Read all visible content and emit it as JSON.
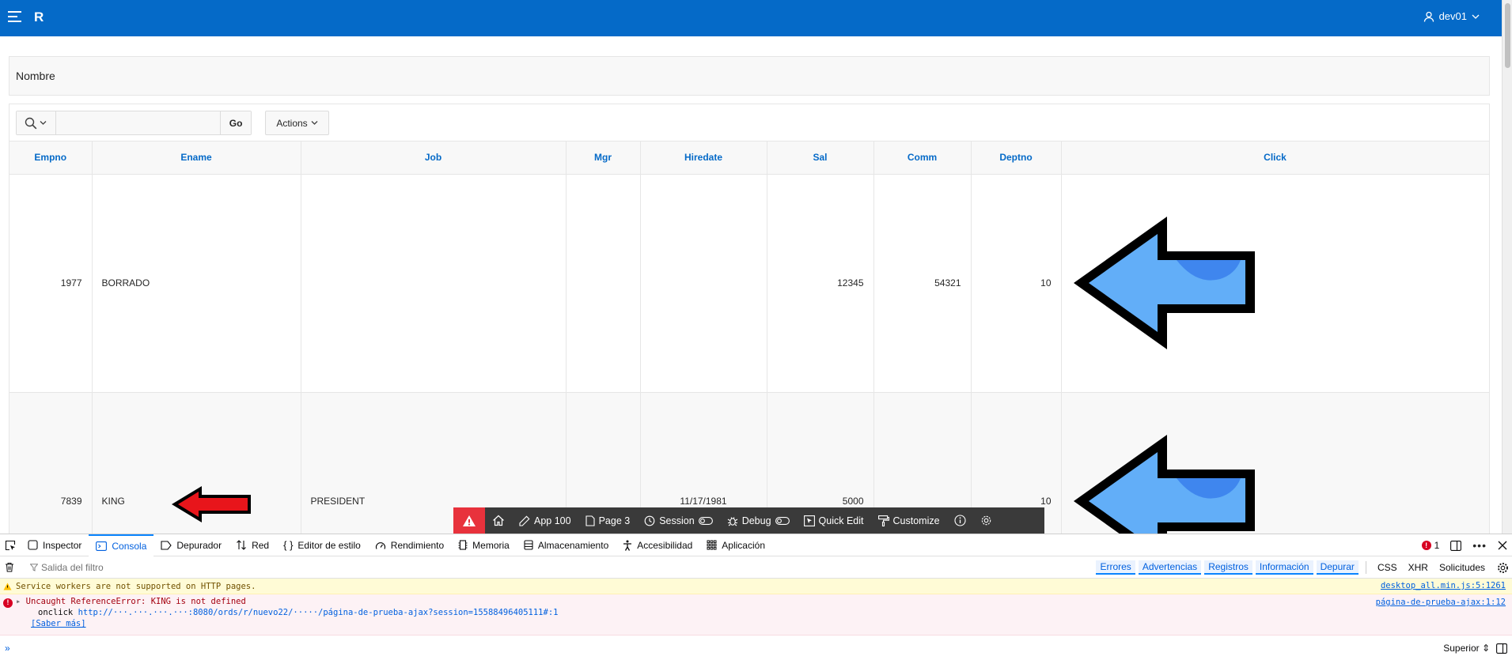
{
  "header": {
    "logo": "R",
    "user_name": "dev01"
  },
  "region": {
    "title": "Nombre"
  },
  "toolbar": {
    "search_value": "",
    "go_label": "Go",
    "actions_label": "Actions"
  },
  "report": {
    "columns": [
      "Empno",
      "Ename",
      "Job",
      "Mgr",
      "Hiredate",
      "Sal",
      "Comm",
      "Deptno",
      "Click"
    ],
    "rows": [
      {
        "empno": "1977",
        "ename": "BORRADO",
        "job": "",
        "mgr": "",
        "hiredate": "",
        "sal": "12345",
        "comm": "54321",
        "deptno": "10"
      },
      {
        "empno": "7839",
        "ename": "KING",
        "job": "PRESIDENT",
        "mgr": "",
        "hiredate": "11/17/1981",
        "sal": "5000",
        "comm": "",
        "deptno": "10"
      }
    ]
  },
  "developer_toolbar": {
    "items": [
      "App 100",
      "Page 3",
      "Session",
      "Debug",
      "Quick Edit",
      "Customize"
    ]
  },
  "devtools": {
    "tabs": [
      "Inspector",
      "Consola",
      "Depurador",
      "Red",
      "Editor de estilo",
      "Rendimiento",
      "Memoria",
      "Almacenamiento",
      "Accesibilidad",
      "Aplicación"
    ],
    "active_tab": "Consola",
    "error_count": "1",
    "filter_placeholder": "Salida del filtro",
    "filters": [
      "Errores",
      "Advertencias",
      "Registros",
      "Información",
      "Depurar"
    ],
    "extra_filters": [
      "CSS",
      "XHR",
      "Solicitudes"
    ],
    "warning_text": "Service workers are not supported on HTTP pages.",
    "warning_location": "desktop_all.min.js:5:1261",
    "error_text": "Uncaught ReferenceError: KING is not defined",
    "error_onclick": "onclick",
    "error_url": "http://···.···.···.···:8080/ords/r/nuevo22/·····/página-de-prueba-ajax?session=15588496405111#:1",
    "error_location": "página-de-prueba-ajax:1:12",
    "learn_more": "[Saber más]",
    "position_label": "Superior"
  },
  "colors": {
    "header_bg": "#056ac8",
    "column_header_text": "#056ac8",
    "devbar_bg": "#3a3a3a",
    "devbar_alert": "#e8323c",
    "arrow_fill": "#62aef8",
    "red_arrow": "#e8151b"
  }
}
